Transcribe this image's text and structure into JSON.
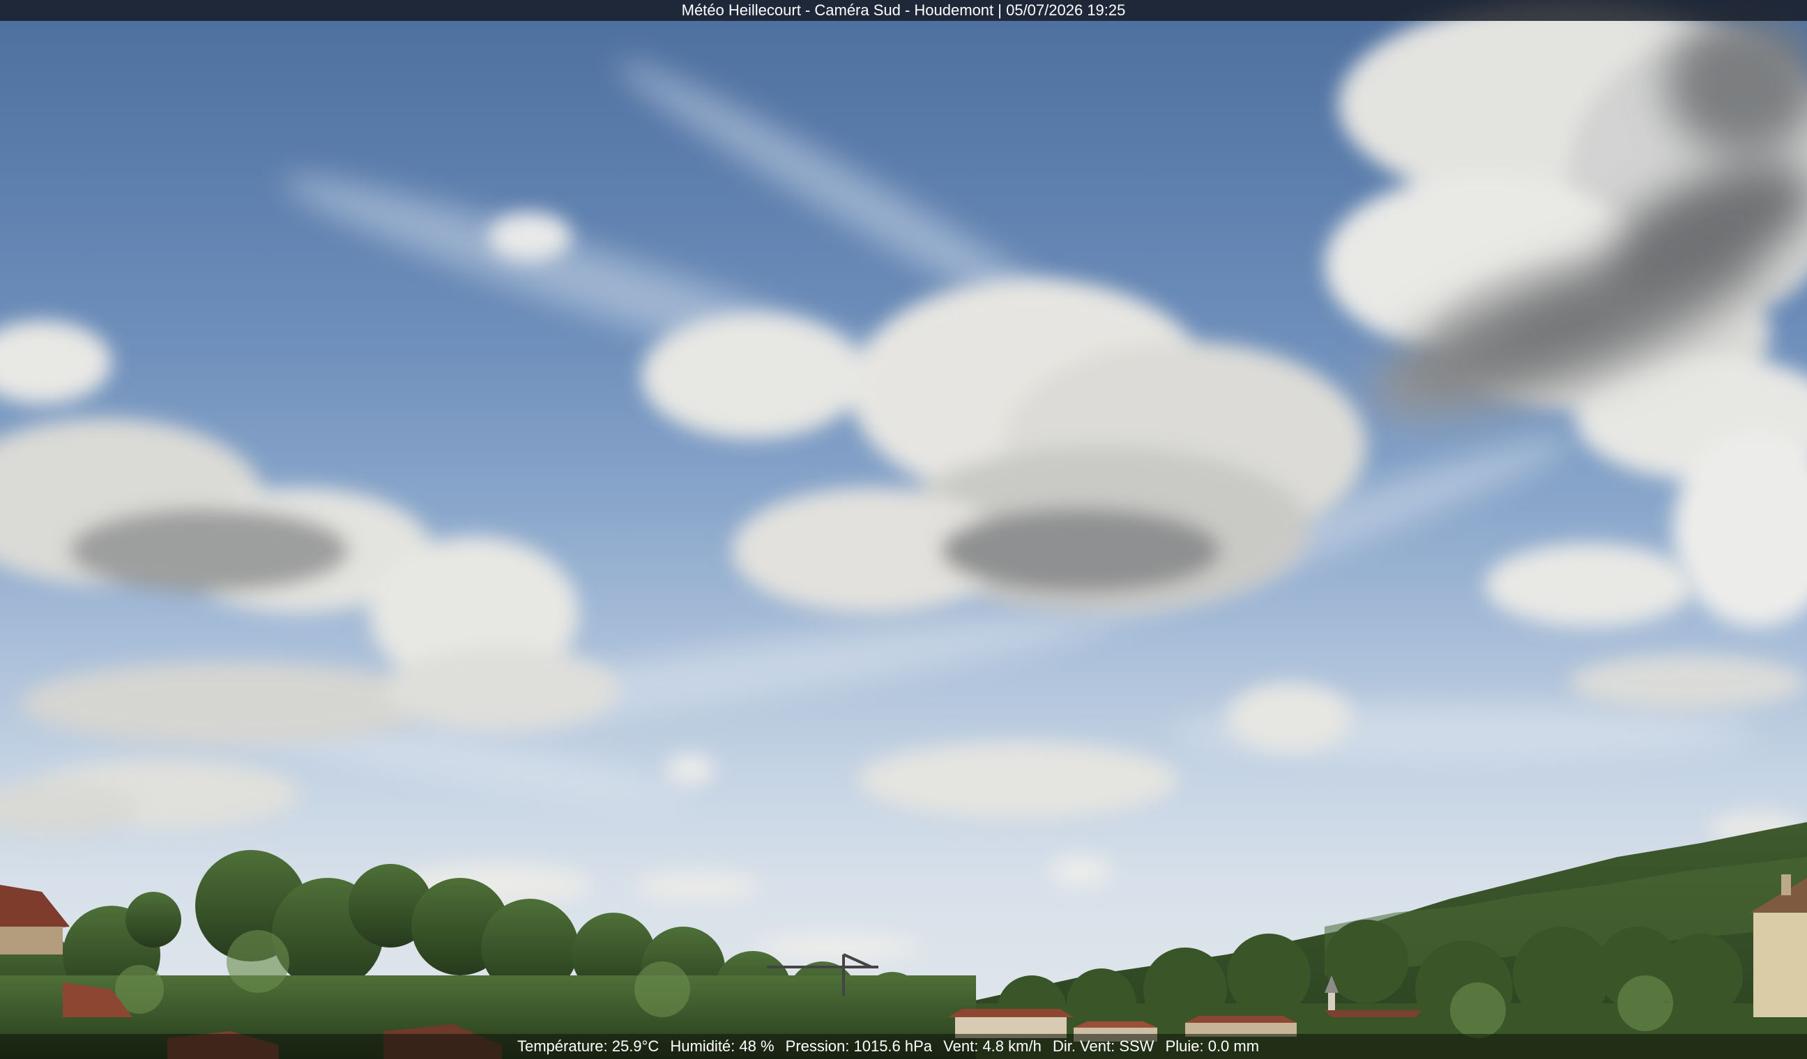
{
  "overlay": {
    "title": "Météo Heillecourt - Caméra Sud - Houdemont | 05/07/2026 19:25"
  },
  "weather": {
    "temperature": "Température: 25.9°C",
    "humidity": "Humidité: 48 %",
    "pressure": "Pression: 1015.6 hPa",
    "wind_speed": "Vent: 4.8 km/h",
    "wind_direction": "Dir. Vent: SSW",
    "rain": "Pluie: 0.0 mm"
  },
  "colors": {
    "sky_top": "#4d6f9e",
    "sky_horizon": "#e2e7ec",
    "vegetation": "#3d5a2c",
    "roof": "#8c4632"
  }
}
